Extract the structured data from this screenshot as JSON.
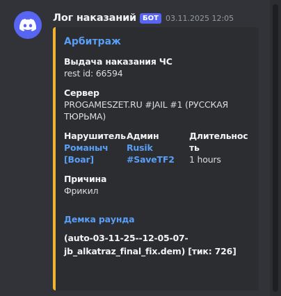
{
  "message": {
    "author": "Лог наказаний",
    "badge": "БОТ",
    "timestamp": "03.11.2025 12:05",
    "avatar_icon": "discord-logo-icon"
  },
  "embed": {
    "accent_color": "#f0b232",
    "title": "Арбитраж",
    "fields": {
      "action": {
        "name": "Выдача наказания ЧС",
        "value": "rest id: 66594"
      },
      "server": {
        "name": "Сервер",
        "value_line1": "PROGAMESZET.RU #JAIL #1 (РУССКАЯ",
        "value_line2": "ТЮРЬМА)"
      },
      "violator": {
        "name": "Нарушитель",
        "value_line1": "Романыч",
        "value_line2": "[Boar]"
      },
      "admin": {
        "name": "Админ",
        "value_line1": "Rusik",
        "value_line2": "#SaveTF2"
      },
      "duration": {
        "name_line1": "Длительнос",
        "name_line2": "ть",
        "value": "1 hours"
      },
      "reason": {
        "name": "Причина",
        "value": "Фрикил"
      }
    },
    "demo": {
      "title": "Демка раунда",
      "value_line1": "(auto-03-11-25--12-05-07-",
      "value_line2": "jb_alkatraz_final_fix.dem) [тик: 726]"
    }
  }
}
